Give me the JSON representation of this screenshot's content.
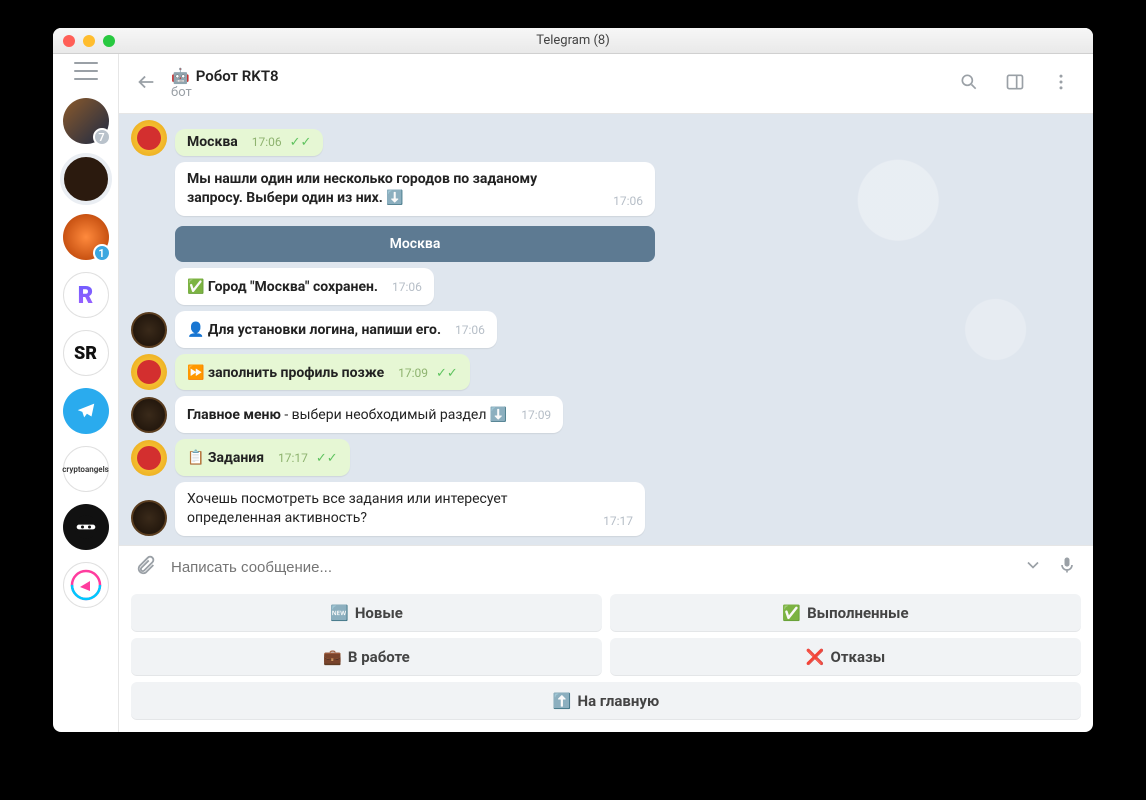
{
  "window": {
    "title": "Telegram (8)"
  },
  "sidebar": {
    "items": [
      {
        "badge": "7"
      },
      {
        "active": true
      },
      {
        "badge": "1"
      },
      {
        "label": "R"
      },
      {
        "label": "SR"
      },
      {},
      {
        "label": "cryptoangels"
      },
      {},
      {}
    ]
  },
  "header": {
    "emoji": "🤖",
    "title": "Робот RKT8",
    "subtitle": "бот"
  },
  "messages": {
    "m0_text": "Москва",
    "m0_time": "17:06",
    "m1_text": "Мы нашли один или несколько городов по заданому запросу. Выбери один из них. ⬇️",
    "m1_time": "17:06",
    "m1_button": "Москва",
    "m2_text": "✅ Город \"Москва\" сохранен.",
    "m2_time": "17:06",
    "m3_text": "👤 Для установки логина, напиши его.",
    "m3_time": "17:06",
    "m4_text": "⏩ заполнить профиль позже",
    "m4_time": "17:09",
    "m5_pre": "Главное меню",
    "m5_text": " - выбери необходимый раздел ⬇️",
    "m5_time": "17:09",
    "m6_text": "📋 Задания",
    "m6_time": "17:17",
    "m7_text": "Хочешь посмотреть все задания или интересует определенная активность?",
    "m7_time": "17:17"
  },
  "composer": {
    "placeholder": "Написать сообщение..."
  },
  "keyboard": {
    "rows": [
      [
        {
          "icon": "🆕",
          "label": "Новые"
        },
        {
          "icon": "✅",
          "label": "Выполненные"
        }
      ],
      [
        {
          "icon": "💼",
          "label": "В работе"
        },
        {
          "icon": "❌",
          "label": "Отказы"
        }
      ],
      [
        {
          "icon": "⬆️",
          "label": "На главную"
        }
      ]
    ]
  }
}
